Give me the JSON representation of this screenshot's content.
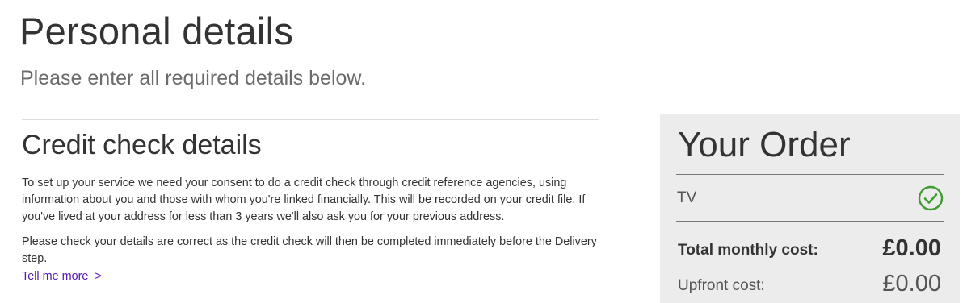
{
  "header": {
    "title": "Personal details",
    "subtitle": "Please enter all required details below."
  },
  "credit_check": {
    "title": "Credit check details",
    "paragraph1": "To set up your service we need your consent to do a credit check through credit reference agencies, using information about you and those with whom you're linked financially. This will be recorded on your credit file. If you've lived at your address for less than 3 years we'll also ask you for your previous address.",
    "paragraph2": "Please check your details are correct as the credit check will then be completed immediately before the Delivery step.",
    "link_label": "Tell me more",
    "link_chevron": ">"
  },
  "order": {
    "title": "Your Order",
    "item_label": "TV",
    "item_status_icon": "check-circle-icon",
    "total_label": "Total monthly cost:",
    "total_value": "£0.00",
    "upfront_label": "Upfront cost:",
    "upfront_value": "£0.00"
  },
  "colors": {
    "link": "#5514b4",
    "check": "#3e9b2f",
    "panel_bg": "#ececec"
  }
}
